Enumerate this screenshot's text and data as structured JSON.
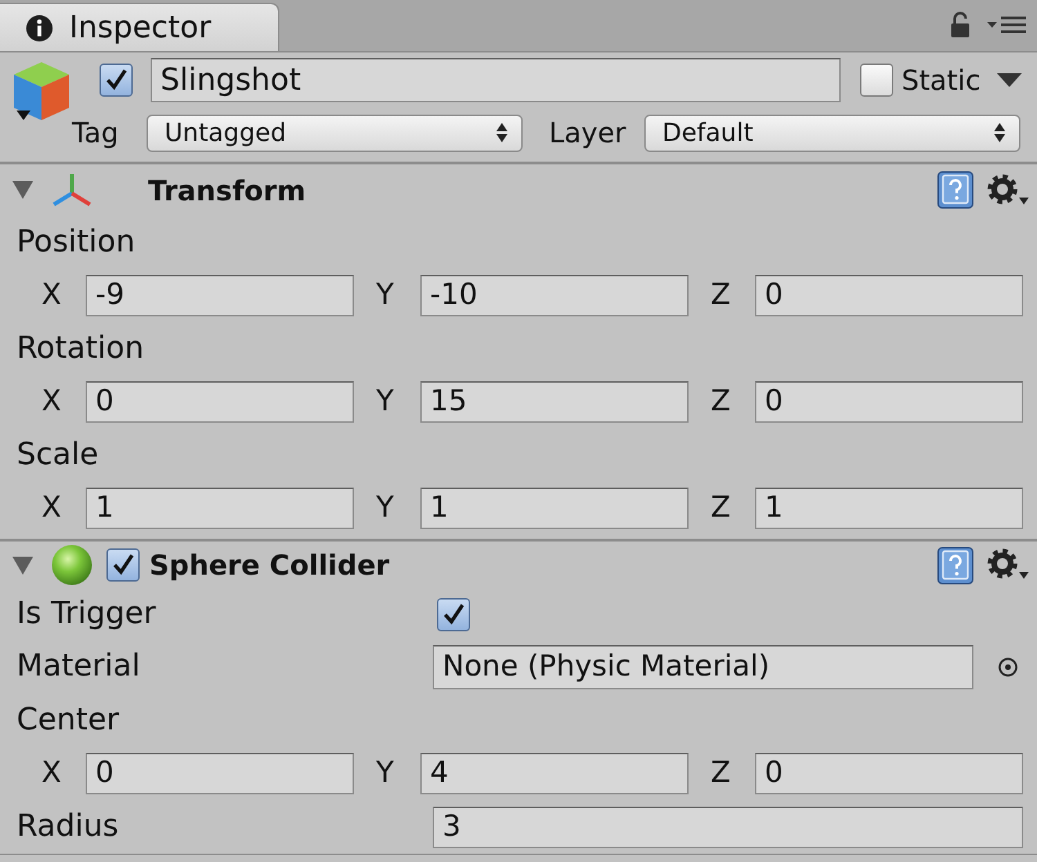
{
  "tabs": [
    {
      "label": "Inspector",
      "selected": true
    }
  ],
  "object": {
    "active": true,
    "name": "Slingshot",
    "static": false,
    "static_label": "Static",
    "tag_label": "Tag",
    "tag": "Untagged",
    "layer_label": "Layer",
    "layer": "Default"
  },
  "components": [
    {
      "kind": "transform",
      "title": "Transform",
      "expanded": true,
      "properties": [
        {
          "kind": "vector",
          "label": "Position",
          "fields": [
            {
              "axis": "X",
              "value": "-9"
            },
            {
              "axis": "Y",
              "value": "-10"
            },
            {
              "axis": "Z",
              "value": "0"
            }
          ]
        },
        {
          "kind": "vector",
          "label": "Rotation",
          "fields": [
            {
              "axis": "X",
              "value": "0"
            },
            {
              "axis": "Y",
              "value": "15"
            },
            {
              "axis": "Z",
              "value": "0"
            }
          ]
        },
        {
          "kind": "vector",
          "label": "Scale",
          "fields": [
            {
              "axis": "X",
              "value": "1"
            },
            {
              "axis": "Y",
              "value": "1"
            },
            {
              "axis": "Z",
              "value": "1"
            }
          ]
        }
      ]
    },
    {
      "kind": "sphere_collider",
      "title": "Sphere Collider",
      "expanded": true,
      "enabled": true,
      "properties": [
        {
          "kind": "toggle",
          "label": "Is Trigger",
          "checked": true
        },
        {
          "kind": "object",
          "label": "Material",
          "value": "None (Physic Material)"
        },
        {
          "kind": "vector",
          "label": "Center",
          "fields": [
            {
              "axis": "X",
              "value": "0"
            },
            {
              "axis": "Y",
              "value": "4"
            },
            {
              "axis": "Z",
              "value": "0"
            }
          ]
        },
        {
          "kind": "number",
          "label": "Radius",
          "value": "3"
        }
      ]
    }
  ]
}
